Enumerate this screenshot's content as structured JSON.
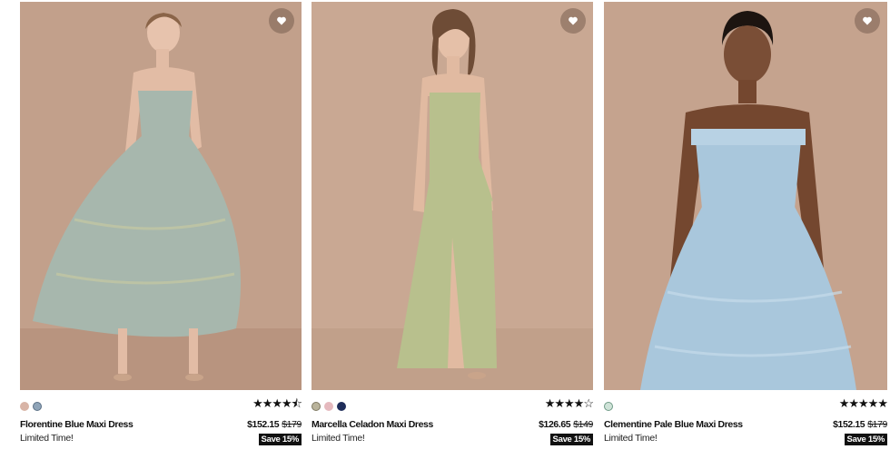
{
  "products": [
    {
      "name": "Florentine Blue Maxi Dress",
      "promo": "Limited Time!",
      "price": "$152.15",
      "original_price": "$179",
      "save_label": "Save 15%",
      "rating_stars": "★★★★⯪",
      "rating": 4.5,
      "swatches": [
        "#d8b4a6",
        "#8fa4b8"
      ],
      "background": "#c2a08b",
      "dress_color": "#a7b7ad"
    },
    {
      "name": "Marcella Celadon Maxi Dress",
      "promo": "Limited Time!",
      "price": "$126.65",
      "original_price": "$149",
      "save_label": "Save 15%",
      "rating_stars": "★★★★☆",
      "rating": 4,
      "swatches": [
        "#b9b39b",
        "#e5b9be",
        "#1f2d5a"
      ],
      "background": "#c9a893",
      "dress_color": "#b8c08d"
    },
    {
      "name": "Clementine Pale Blue Maxi Dress",
      "promo": "Limited Time!",
      "price": "$152.15",
      "original_price": "$179",
      "save_label": "Save 15%",
      "rating_stars": "★★★★★",
      "rating": 5,
      "swatches": [
        "#cfe3d8"
      ],
      "background": "#c5a38e",
      "dress_color": "#a9c7dc"
    }
  ]
}
